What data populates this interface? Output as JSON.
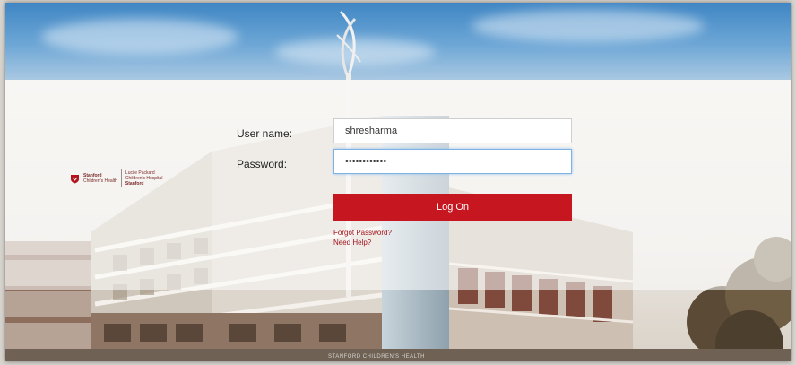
{
  "logo": {
    "line1": "Stanford",
    "line2": "Children's Health",
    "line3": "Lucile Packard",
    "line4": "Children's Hospital",
    "line5": "Stanford"
  },
  "form": {
    "username_label": "User name:",
    "username_value": "shresharma",
    "password_label": "Password:",
    "password_value": "••••••••••••",
    "logon_label": "Log On",
    "forgot_label": "Forgot Password?",
    "help_label": "Need Help?"
  },
  "footer": {
    "text": "STANFORD CHILDREN'S HEALTH"
  },
  "colors": {
    "brand_red": "#c6161f",
    "link_red": "#a3141c"
  }
}
